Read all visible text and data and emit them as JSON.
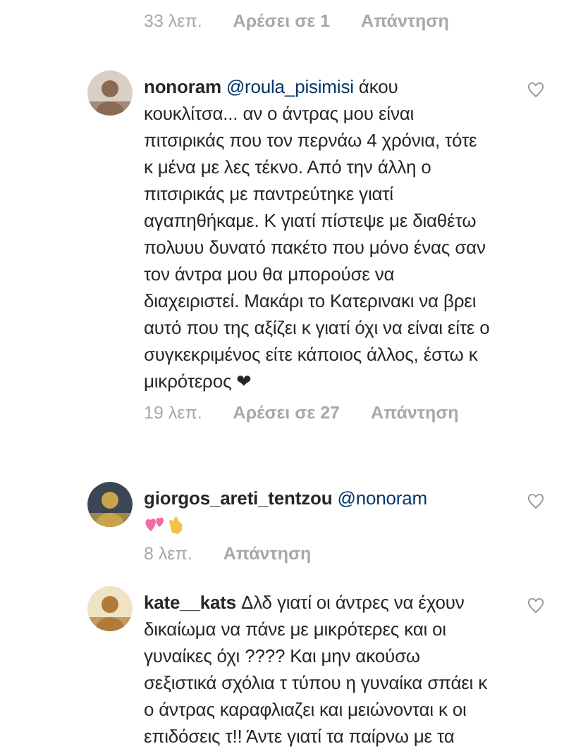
{
  "top_meta": {
    "time": "33 λεπ.",
    "likes": "Αρέσει σε 1",
    "reply": "Απάντηση"
  },
  "comments": [
    {
      "kind": "text",
      "username": "nonoram",
      "mention": "@roula_pisimisi",
      "text": "άκου κουκλίτσα... αν ο άντρας μου είναι πιτσιρικάς που τον περνάω 4 χρόνια, τότε κ μένα με λες τέκνο. Από την άλλη ο πιτσιρικάς με παντρεύτηκε γιατί αγαπηθήκαμε. Κ γιατί πίστεψε με διαθέτω πολυυυ δυνατό πακέτο που μόνο ένας σαν τον άντρα μου θα μπορούσε να διαχειριστεί. Μακάρι το Κατερινακι να βρει αυτό που της αξίζει κ γιατί όχι να είναι είτε ο συγκεκριμένος είτε κάποιος άλλος, έστω κ μικρότερος ❤",
      "time": "19 λεπ.",
      "likes": "Αρέσει σε 27",
      "reply": "Απάντηση"
    },
    {
      "kind": "emoji-reply",
      "username": "giorgos_areti_tentzou",
      "mention": "@nonoram",
      "time": "8 λεπ.",
      "reply": "Απάντηση"
    },
    {
      "kind": "text",
      "username": "kate__kats",
      "text": "Δλδ γιατί οι άντρες να έχουν δικαίωμα να πάνε με μικρότερες και οι γυναίκες όχι ???? Και μην ακούσω σεξιστικά σχόλια τ τύπου η γυναίκα σπάει κ ο άντρας καραφλιαζει και μειώνονται κ οι επιδόσεις τ!! Άντε γιατί τα παίρνω με τα"
    }
  ]
}
